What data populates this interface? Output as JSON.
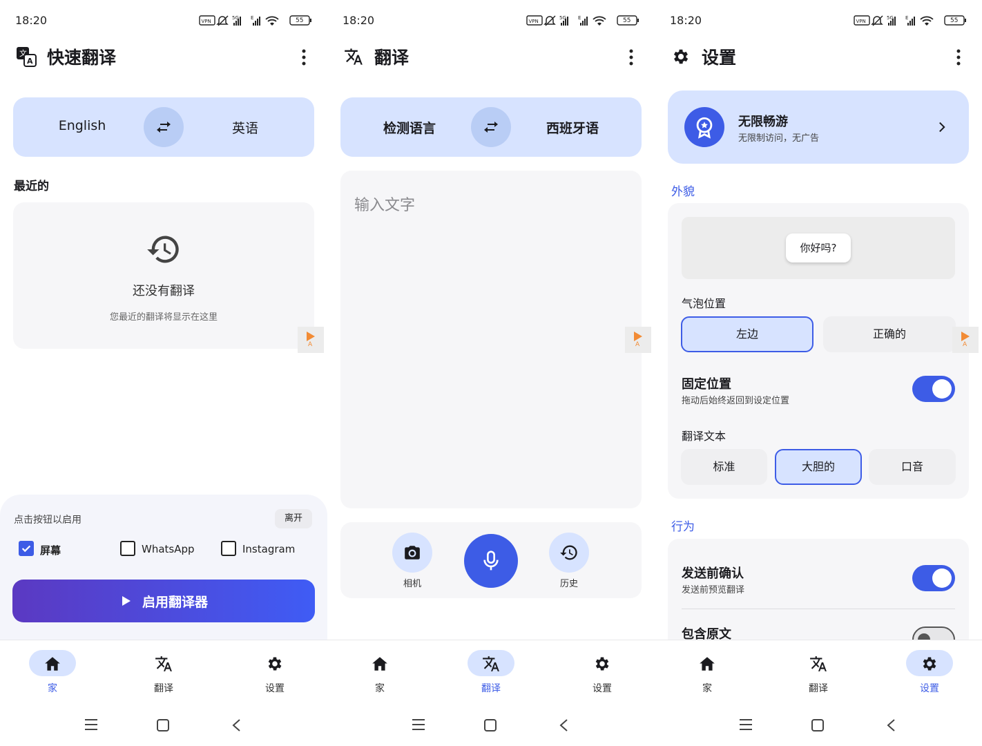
{
  "status": {
    "time": "18:20",
    "battery": "55"
  },
  "colors": {
    "accent": "#3d5ce6",
    "tonal": "#d7e3ff",
    "surface": "#f6f6f8",
    "ad_orange": "#f28b35"
  },
  "home": {
    "title": "快速翻译",
    "source_lang": "English",
    "target_lang": "英语",
    "recent_label": "最近的",
    "empty_title": "还没有翻译",
    "empty_subtitle": "您最近的翻译将显示在这里",
    "ad_label": "A",
    "panel_hint": "点击按钮以启用",
    "leave_label": "离开",
    "checkboxes": [
      {
        "label": "屏幕",
        "checked": true
      },
      {
        "label": "WhatsApp",
        "checked": false
      },
      {
        "label": "Instagram",
        "checked": false
      }
    ],
    "enable_button": "启用翻译器"
  },
  "translate": {
    "title": "翻译",
    "source_lang": "检测语言",
    "target_lang": "西班牙语",
    "input_placeholder": "输入文字",
    "ad_label": "A",
    "camera_label": "相机",
    "history_label": "历史"
  },
  "settings": {
    "title": "设置",
    "promo_title": "无限畅游",
    "promo_subtitle": "无限制访问，无广告",
    "appearance_label": "外貌",
    "bubble_preview": "你好吗?",
    "bubble_position_label": "气泡位置",
    "bubble_positions": [
      {
        "label": "左边",
        "selected": true
      },
      {
        "label": "正确的",
        "selected": false
      }
    ],
    "ad_label": "A",
    "fixed_position_title": "固定位置",
    "fixed_position_sub": "拖动后始终返回到设定位置",
    "fixed_position_on": true,
    "translate_text_label": "翻译文本",
    "text_styles": [
      {
        "label": "标准",
        "selected": false
      },
      {
        "label": "大胆的",
        "selected": true
      },
      {
        "label": "口音",
        "selected": false
      }
    ],
    "behavior_label": "行为",
    "confirm_title": "发送前确认",
    "confirm_sub": "发送前预览翻译",
    "confirm_on": true,
    "include_original_title": "包含原文",
    "include_original_on": false
  },
  "nav": {
    "home": "家",
    "translate": "翻译",
    "settings": "设置"
  }
}
